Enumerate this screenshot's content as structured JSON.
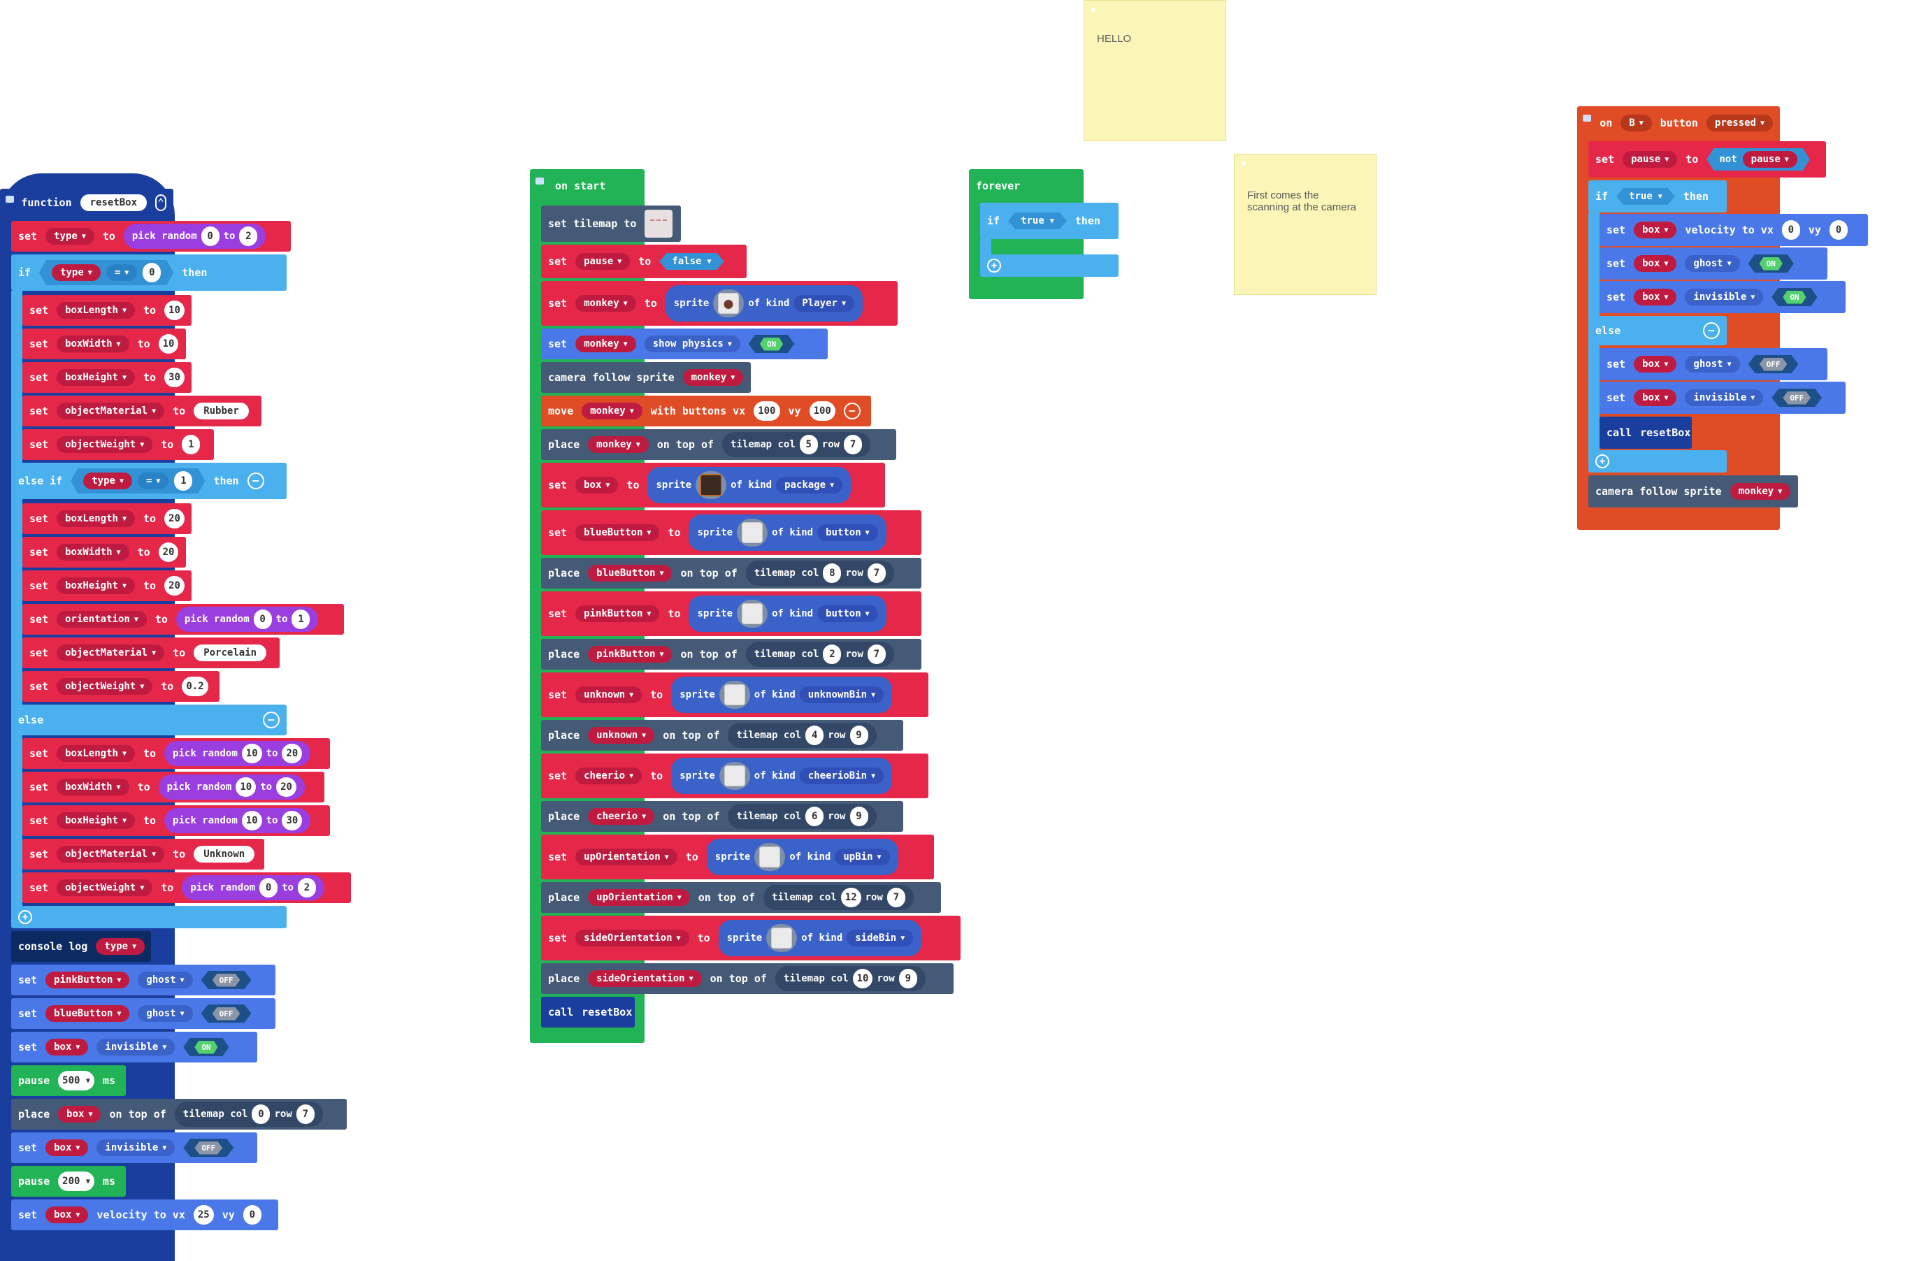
{
  "colors": {
    "variables": "#e5274a",
    "logic": "#4ab0ee",
    "sprites": "#4a78e8",
    "scene": "#455a76",
    "controller": "#e04c25",
    "loops": "#22b356",
    "functions": "#1a3e9e",
    "console": "#0c2b62",
    "note": "#fbf5b8"
  },
  "kw": {
    "set": "set",
    "to": "to",
    "if": "if",
    "then": "then",
    "else_if": "else if",
    "else": "else",
    "function": "function",
    "on_start": "on start",
    "forever": "forever",
    "pick_random": "pick random",
    "place": "place",
    "on_top_of": "on top of",
    "tilemap_col": "tilemap col",
    "row": "row",
    "sprite": "sprite",
    "of_kind": "of kind",
    "call": "call",
    "console_log": "console log",
    "pause": "pause",
    "ms": "ms",
    "camera_follow": "camera follow sprite",
    "velocity_to_vx": "velocity to vx",
    "vy": "vy",
    "move": "move",
    "with_buttons_vx": "with buttons vx",
    "set_tilemap_to": "set tilemap to",
    "show_physics": "show physics",
    "ghost": "ghost",
    "invisible": "invisible",
    "on": "on",
    "button": "button",
    "pressed": "pressed",
    "not": "not",
    "eq": "=",
    "on_label": "ON",
    "off_label": "OFF"
  },
  "notes": {
    "hello": "HELLO",
    "camera": "First comes the scanning at the camera"
  },
  "func": {
    "name": "resetBox",
    "set_type": {
      "var": "type",
      "from": "0",
      "to": "2"
    },
    "if_cond": {
      "var": "type",
      "value": "0"
    },
    "if_body": [
      [
        "boxLength",
        "10"
      ],
      [
        "boxWidth",
        "10"
      ],
      [
        "boxHeight",
        "30"
      ],
      [
        "objectMaterial",
        "Rubber"
      ],
      [
        "objectWeight",
        "1"
      ]
    ],
    "elseif_cond": {
      "var": "type",
      "value": "1"
    },
    "elseif_body": [
      [
        "boxLength",
        "20"
      ],
      [
        "boxWidth",
        "20"
      ],
      [
        "boxHeight",
        "20"
      ]
    ],
    "orientation": {
      "var": "orientation",
      "from": "0",
      "to": "1"
    },
    "elseif_body2": [
      [
        "objectMaterial",
        "Porcelain"
      ],
      [
        "objectWeight",
        "0.2"
      ]
    ],
    "else_body": [
      [
        "boxLength",
        "10",
        "20"
      ],
      [
        "boxWidth",
        "10",
        "20"
      ],
      [
        "boxHeight",
        "10",
        "30"
      ]
    ],
    "else_material": [
      "objectMaterial",
      "Unknown"
    ],
    "else_weight": [
      "objectWeight",
      "0",
      "2"
    ],
    "log_var": "type",
    "ghost1": "pinkButton",
    "ghost2": "blueButton",
    "inv_box": "box",
    "pause1": "500",
    "place_box": {
      "sprite": "box",
      "col": "0",
      "row": "7"
    },
    "inv_box2": "box",
    "pause2": "200",
    "vel": {
      "sprite": "box",
      "vx": "25",
      "vy": "0"
    }
  },
  "start": {
    "pause_var": "pause",
    "pause_val": "false",
    "monkey": "monkey",
    "player_kind": "Player",
    "move": {
      "sprite": "monkey",
      "vx": "100",
      "vy": "100"
    },
    "place_monkey": {
      "sprite": "monkey",
      "col": "5",
      "row": "7"
    },
    "box": "box",
    "package_kind": "package",
    "blue": "blueButton",
    "button_kind": "button",
    "place_blue": {
      "col": "8",
      "row": "7"
    },
    "pink": "pinkButton",
    "place_pink": {
      "col": "2",
      "row": "7"
    },
    "unknown": "unknown",
    "unknown_kind": "unknownBin",
    "place_unknown": {
      "col": "4",
      "row": "9"
    },
    "cheerio": "cheerio",
    "cheerio_kind": "cheerioBin",
    "place_cheerio": {
      "col": "6",
      "row": "9"
    },
    "up": "upOrientation",
    "up_kind": "upBin",
    "place_up": {
      "col": "12",
      "row": "7"
    },
    "side": "sideOrientation",
    "side_kind": "sideBin",
    "place_side": {
      "col": "10",
      "row": "9"
    },
    "call": "resetBox"
  },
  "forever": {
    "cond": "true"
  },
  "onb": {
    "button": "B",
    "pause_var": "pause",
    "not_var": "pause",
    "cond": "true",
    "box": "box",
    "vx": "0",
    "vy": "0",
    "call": "resetBox",
    "follow": "monkey"
  }
}
